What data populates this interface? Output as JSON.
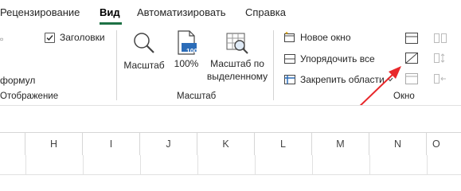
{
  "tabs": [
    {
      "label": "Рецензирование",
      "active": false
    },
    {
      "label": "Вид",
      "active": true
    },
    {
      "label": "Автоматизировать",
      "active": false
    },
    {
      "label": "Справка",
      "active": false
    }
  ],
  "show_group": {
    "headings_checkbox_label": "Заголовки",
    "headings_checked": true,
    "formula_label_partial": "формул",
    "group_label_partial": "Отображение"
  },
  "zoom_group": {
    "zoom_label": "Масштаб",
    "zoom100_label": "100%",
    "zoom100_icon_text": "100",
    "zoom_selection_line1": "Масштаб по",
    "zoom_selection_line2": "выделенному",
    "group_label": "Масштаб"
  },
  "window_group": {
    "new_window": "Новое окно",
    "arrange_all": "Упорядочить все",
    "freeze_panes": "Закрепить области",
    "group_label": "Окно"
  },
  "columns": [
    "H",
    "I",
    "J",
    "K",
    "L",
    "M",
    "N",
    "O"
  ],
  "colors": {
    "accent_green": "#1e7145",
    "arrow_red": "#e8282b"
  }
}
